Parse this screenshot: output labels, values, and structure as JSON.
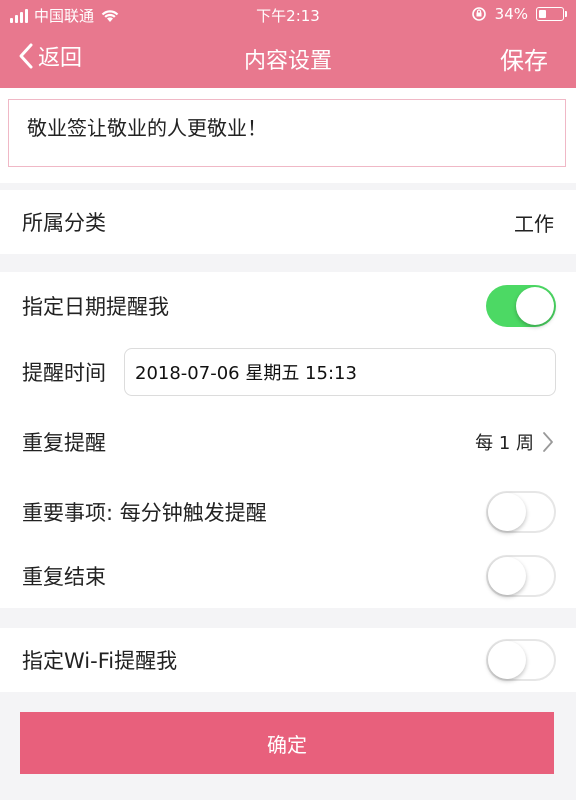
{
  "status_bar": {
    "carrier": "中国联通",
    "time": "下午2:13",
    "battery": "34%"
  },
  "nav": {
    "back_label": "返回",
    "title": "内容设置",
    "save_label": "保存"
  },
  "content": {
    "text": "敬业签让敬业的人更敬业！"
  },
  "category": {
    "label": "所属分类",
    "value": "工作"
  },
  "reminder": {
    "date_label": "指定日期提醒我",
    "date_enabled": true,
    "time_label": "提醒时间",
    "time_value": "2018-07-06 星期五 15:13",
    "repeat_label": "重复提醒",
    "repeat_value": "每 1 周",
    "important_label": "重要事项: 每分钟触发提醒",
    "important_enabled": false,
    "repeat_end_label": "重复结束",
    "repeat_end_enabled": false
  },
  "wifi": {
    "label": "指定Wi-Fi提醒我",
    "enabled": false
  },
  "confirm_label": "确定",
  "colors": {
    "header": "#e8788e",
    "confirm": "#e8607c",
    "toggle_on": "#4cd964"
  }
}
